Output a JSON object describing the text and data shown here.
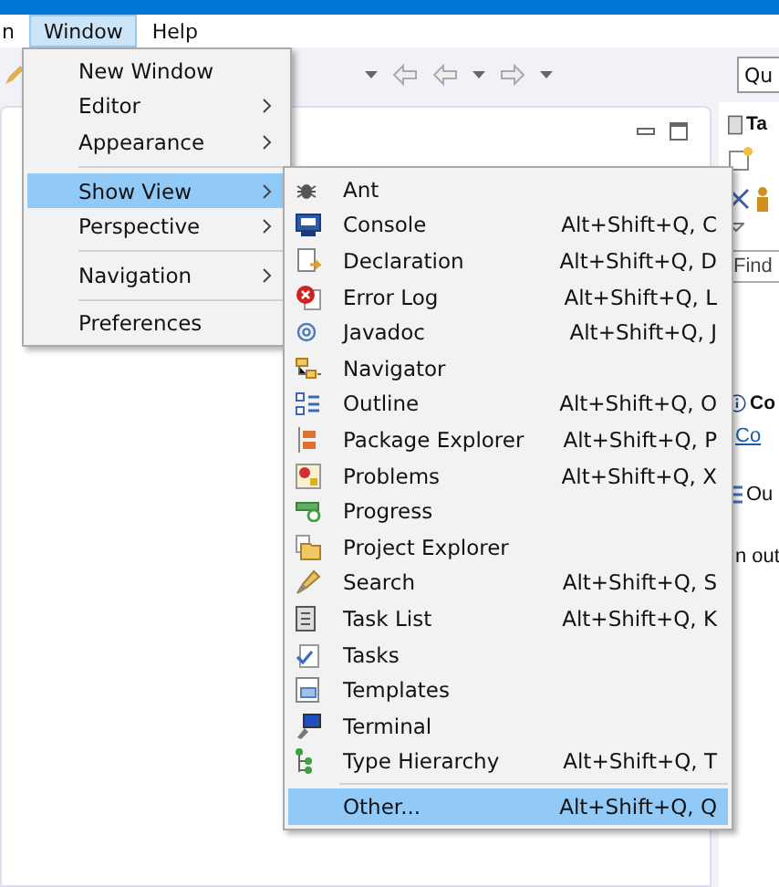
{
  "menubar": [
    {
      "label": "n",
      "selected": false
    },
    {
      "label": "Window",
      "selected": true
    },
    {
      "label": "Help",
      "selected": false
    }
  ],
  "search": {
    "value": "Qu"
  },
  "right_panel": {
    "tab": "Ta",
    "find": {
      "placeholder": "Find"
    },
    "heading": "Co",
    "link": "Co",
    "outline_tab": "Ou",
    "text": "n out"
  },
  "window_menu": [
    {
      "kind": "item",
      "label": "New Window",
      "submenu": false,
      "selected": false
    },
    {
      "kind": "item",
      "label": "Editor",
      "submenu": true,
      "selected": false
    },
    {
      "kind": "item",
      "label": "Appearance",
      "submenu": true,
      "selected": false
    },
    {
      "kind": "separator"
    },
    {
      "kind": "item",
      "label": "Show View",
      "submenu": true,
      "selected": true
    },
    {
      "kind": "item",
      "label": "Perspective",
      "submenu": true,
      "selected": false
    },
    {
      "kind": "separator"
    },
    {
      "kind": "item",
      "label": "Navigation",
      "submenu": true,
      "selected": false
    },
    {
      "kind": "separator"
    },
    {
      "kind": "item",
      "label": "Preferences",
      "submenu": false,
      "selected": false
    }
  ],
  "show_view_menu": [
    {
      "kind": "item",
      "label": "Ant",
      "selected": false
    },
    {
      "kind": "item",
      "label": "Console",
      "shortcut": "Alt+Shift+Q, C",
      "selected": false
    },
    {
      "kind": "item",
      "label": "Declaration",
      "shortcut": "Alt+Shift+Q, D",
      "selected": false
    },
    {
      "kind": "item",
      "label": "Error Log",
      "shortcut": "Alt+Shift+Q, L",
      "selected": false
    },
    {
      "kind": "item",
      "label": "Javadoc",
      "shortcut": "Alt+Shift+Q, J",
      "selected": false
    },
    {
      "kind": "item",
      "label": "Navigator",
      "selected": false
    },
    {
      "kind": "item",
      "label": "Outline",
      "shortcut": "Alt+Shift+Q, O",
      "selected": false
    },
    {
      "kind": "item",
      "label": "Package Explorer",
      "shortcut": "Alt+Shift+Q, P",
      "selected": false
    },
    {
      "kind": "item",
      "label": "Problems",
      "shortcut": "Alt+Shift+Q, X",
      "selected": false
    },
    {
      "kind": "item",
      "label": "Progress",
      "selected": false
    },
    {
      "kind": "item",
      "label": "Project Explorer",
      "selected": false
    },
    {
      "kind": "item",
      "label": "Search",
      "shortcut": "Alt+Shift+Q, S",
      "selected": false
    },
    {
      "kind": "item",
      "label": "Task List",
      "shortcut": "Alt+Shift+Q, K",
      "selected": false
    },
    {
      "kind": "item",
      "label": "Tasks",
      "selected": false
    },
    {
      "kind": "item",
      "label": "Templates",
      "selected": false
    },
    {
      "kind": "item",
      "label": "Terminal",
      "selected": false
    },
    {
      "kind": "item",
      "label": "Type Hierarchy",
      "shortcut": "Alt+Shift+Q, T",
      "selected": false
    },
    {
      "kind": "separator"
    },
    {
      "kind": "item",
      "label": "Other...",
      "shortcut": "Alt+Shift+Q, Q",
      "selected": true
    }
  ]
}
